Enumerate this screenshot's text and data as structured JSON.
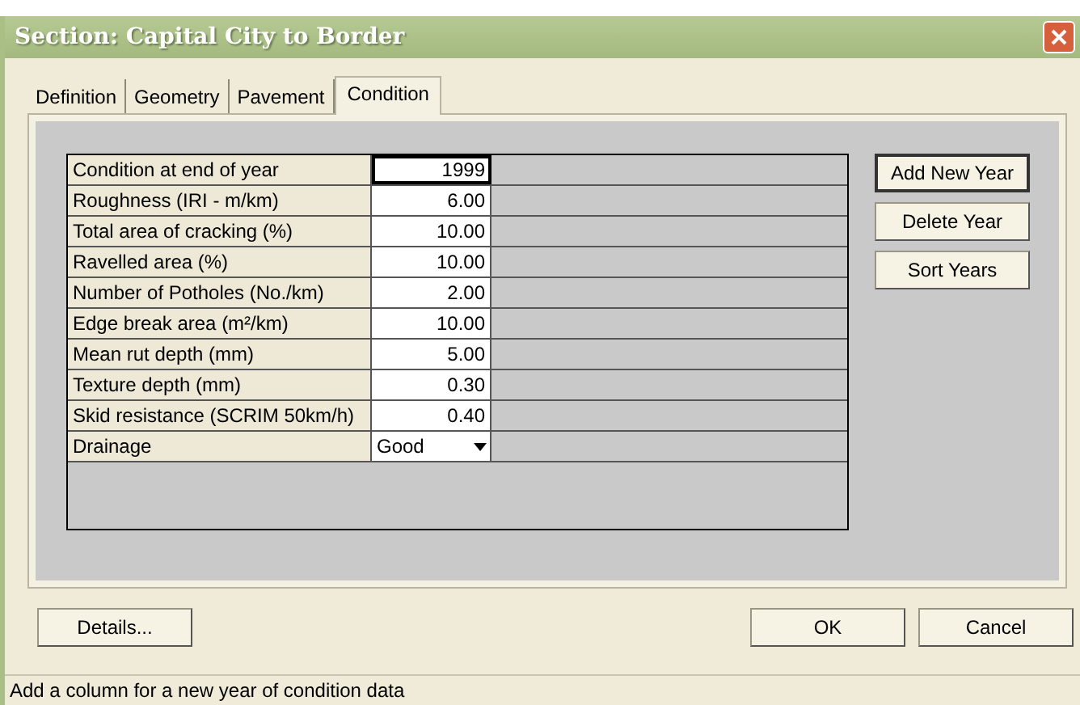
{
  "window": {
    "title": "Section: Capital City to Border"
  },
  "tabs": [
    {
      "label": "Definition",
      "selected": false
    },
    {
      "label": "Geometry",
      "selected": false
    },
    {
      "label": "Pavement",
      "selected": false
    },
    {
      "label": "Condition",
      "selected": true
    }
  ],
  "grid": {
    "rows": [
      {
        "label": "Condition at end of year",
        "value": "1999",
        "kind": "number",
        "selected": true
      },
      {
        "label": "Roughness (IRI - m/km)",
        "value": "6.00",
        "kind": "number",
        "selected": false
      },
      {
        "label": "Total area of cracking (%)",
        "value": "10.00",
        "kind": "number",
        "selected": false
      },
      {
        "label": "Ravelled area (%)",
        "value": "10.00",
        "kind": "number",
        "selected": false
      },
      {
        "label": "Number of Potholes (No./km)",
        "value": "2.00",
        "kind": "number",
        "selected": false
      },
      {
        "label": "Edge break area (m²/km)",
        "value": "10.00",
        "kind": "number",
        "selected": false
      },
      {
        "label": "Mean rut depth (mm)",
        "value": "5.00",
        "kind": "number",
        "selected": false
      },
      {
        "label": "Texture depth (mm)",
        "value": "0.30",
        "kind": "number",
        "selected": false
      },
      {
        "label": "Skid resistance (SCRIM 50km/h)",
        "value": "0.40",
        "kind": "number",
        "selected": false
      },
      {
        "label": "Drainage",
        "value": "Good",
        "kind": "dropdown",
        "selected": false
      }
    ]
  },
  "side_buttons": [
    {
      "label": "Add New Year",
      "selected": true
    },
    {
      "label": "Delete Year",
      "selected": false
    },
    {
      "label": "Sort Years",
      "selected": false
    }
  ],
  "footer": {
    "left_button": "Details...",
    "right_buttons": [
      "OK",
      "Cancel"
    ]
  },
  "status_bar": "Add a column for a new year of condition data"
}
